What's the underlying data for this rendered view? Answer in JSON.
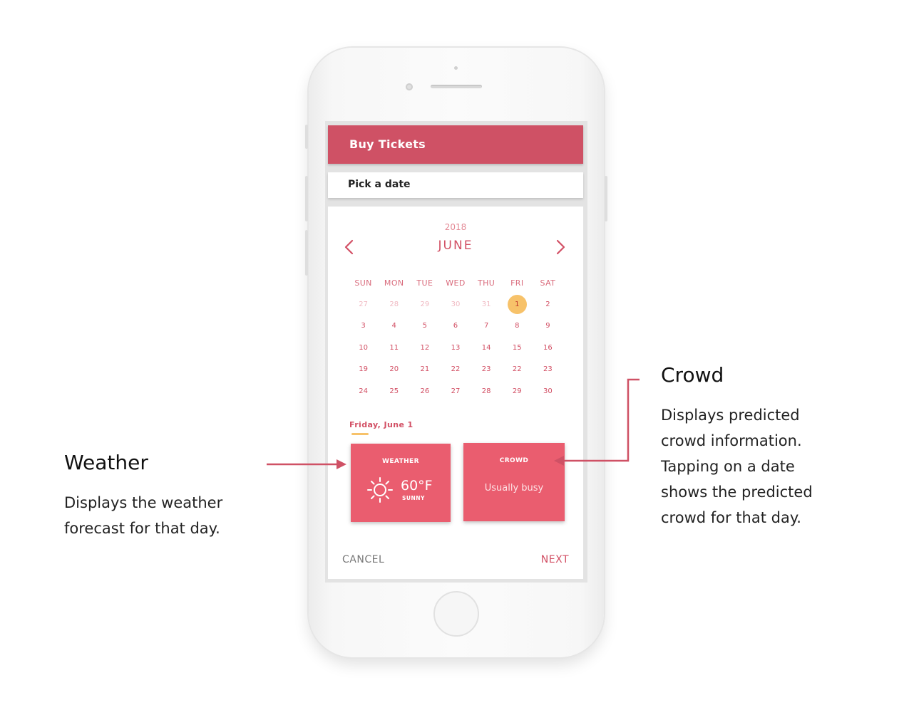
{
  "app": {
    "header_title": "Buy Tickets",
    "subheader": "Pick a date"
  },
  "calendar": {
    "year": "2018",
    "month": "JUNE",
    "weekdays": [
      "SUN",
      "MON",
      "TUE",
      "WED",
      "THU",
      "FRI",
      "SAT"
    ],
    "weeks": [
      [
        "27",
        "28",
        "29",
        "30",
        "31",
        "1",
        "2"
      ],
      [
        "3",
        "4",
        "5",
        "6",
        "7",
        "8",
        "9"
      ],
      [
        "10",
        "11",
        "12",
        "13",
        "14",
        "15",
        "16"
      ],
      [
        "19",
        "20",
        "21",
        "22",
        "23",
        "22",
        "23"
      ],
      [
        "24",
        "25",
        "26",
        "27",
        "28",
        "29",
        "30"
      ]
    ],
    "selected_label": "Friday, June 1"
  },
  "weather": {
    "title": "WEATHER",
    "temp": "60°F",
    "condition": "SUNNY",
    "icon": "sun-icon"
  },
  "crowd": {
    "title": "CROWD",
    "value": "Usually busy"
  },
  "actions": {
    "cancel": "CANCEL",
    "next": "NEXT"
  },
  "annotations": {
    "weather": {
      "title": "Weather",
      "lines": [
        "Displays the weather",
        "forecast for that day."
      ]
    },
    "crowd": {
      "title": "Crowd",
      "lines": [
        "Displays predicted",
        "crowd information.",
        "Tapping on a date",
        "shows the predicted",
        "crowd for that day."
      ]
    }
  },
  "colors": {
    "accent": "#cf5165",
    "tile": "#ea5d6f",
    "selected_day": "#f7c26a",
    "arrow": "#d24f64"
  }
}
